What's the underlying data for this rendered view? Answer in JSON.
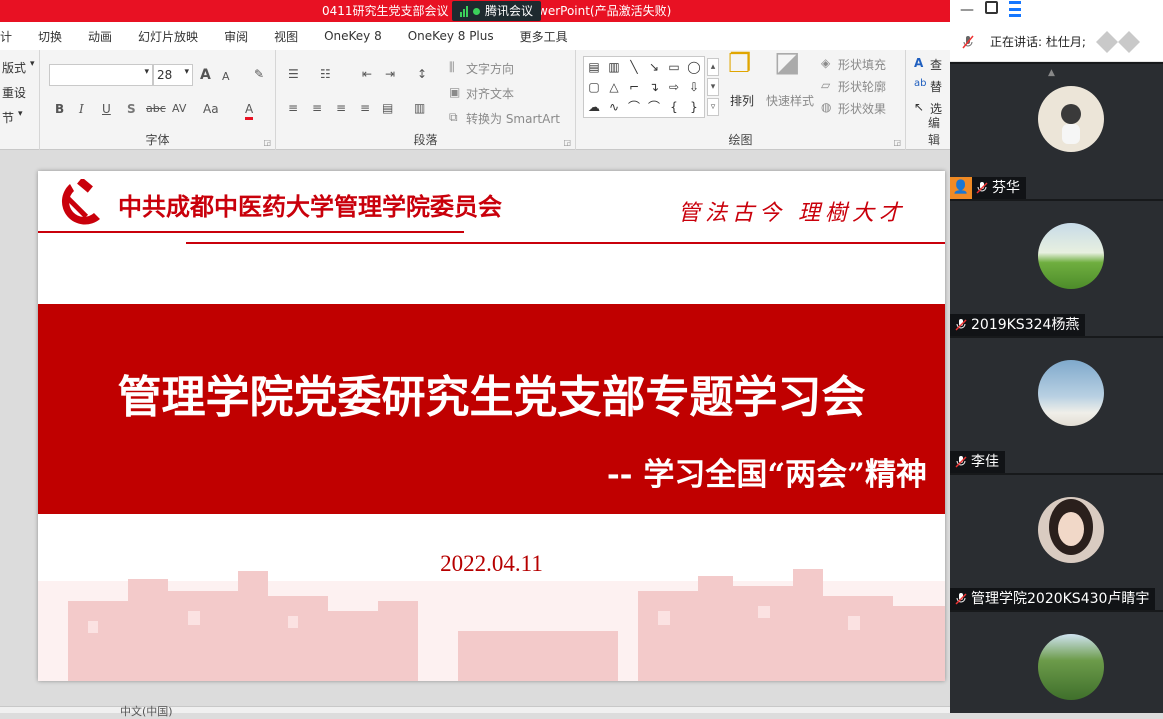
{
  "window": {
    "title_left": "0411研究生党支部会议",
    "title_right": "werPoint(产品激活失败)",
    "meeting_app": "腾讯会议"
  },
  "ribbon_tabs": [
    "计",
    "切换",
    "动画",
    "幻灯片放映",
    "审阅",
    "视图",
    "OneKey 8",
    "OneKey 8 Plus",
    "更多工具"
  ],
  "ribbon": {
    "slides_group": {
      "layout": "版式",
      "reset": "重设",
      "section": "节"
    },
    "font_group": {
      "label": "字体",
      "font_size": "28",
      "grow": "A",
      "shrink": "A",
      "bold": "B",
      "italic": "I",
      "underline": "U",
      "shadow": "S",
      "strike": "abc",
      "spacing": "AV",
      "case": "Aa",
      "color": "A"
    },
    "paragraph_group": {
      "label": "段落",
      "text_direction": "文字方向",
      "align_text": "对齐文本",
      "smartart": "转换为 SmartArt"
    },
    "drawing_group": {
      "label": "绘图",
      "arrange": "排列",
      "quick_styles": "快速样式",
      "shape_fill": "形状填充",
      "shape_outline": "形状轮廓",
      "shape_effects": "形状效果"
    },
    "editing_group": {
      "label": "编辑",
      "find": "查",
      "replace": "替",
      "select": "选"
    }
  },
  "slide": {
    "party_name": "中共成都中医药大学管理学院委员会",
    "motto": "管法古今 理樹大才",
    "main_title": "管理学院党委研究生党支部专题学习会",
    "sub_title": "-- 学习全国“两会”精神",
    "date": "2022.04.11"
  },
  "status_bar": {
    "language": "中文(中国)"
  },
  "meeting_panel": {
    "speaking_label": "正在讲话: 杜仕月;",
    "participants": [
      {
        "name": "芬华",
        "host": true,
        "avatar_color": "#e9e2d6"
      },
      {
        "name": "2019KS324杨燕",
        "host": false,
        "avatar_color": "#7fb35a"
      },
      {
        "name": "李佳",
        "host": false,
        "avatar_color": "#9ec1dc"
      },
      {
        "name": "管理学院2020KS430卢睛宇",
        "host": false,
        "avatar_color": "#d8c8be"
      },
      {
        "name": "",
        "host": false,
        "avatar_color": "#4f7a3a"
      }
    ]
  },
  "colors": {
    "ppt_titlebar": "#e81123",
    "party_red": "#c9000b",
    "band_red": "#c00000",
    "panel_bg": "#1f2226"
  }
}
